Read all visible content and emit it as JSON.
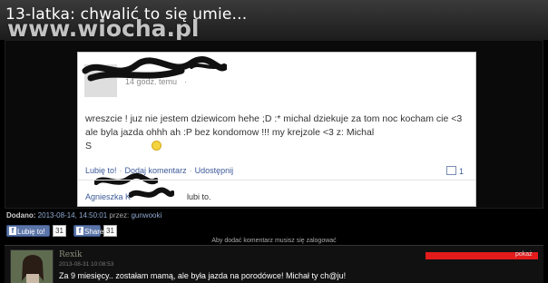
{
  "title": "13-latka: chwalić to się umie...",
  "logo": "www.wiocha.pl",
  "post": {
    "timestamp": "14 godz. temu",
    "text": "wreszcie ! juz nie jestem dziewicom hehe ;D :* michal dziekuje za tom noc kocham cie <3 ale byla jazda ohhh ah :P bez kondomow !!! my krejzole <3 z: Michal",
    "text_tail": "S",
    "actions": [
      "Lubię to!",
      "Dodaj komentarz",
      "Udostępnij"
    ],
    "comment_count": "1",
    "likes_prefix": "Agnieszka K",
    "likes_suffix": "lubi to."
  },
  "meta": {
    "added_label": "Dodano:",
    "added_value": "2013-08-14, 14:50:01",
    "by_label": "przez:",
    "by_value": "gunwooki"
  },
  "share": {
    "like_label": "Lubię to!",
    "like_count": "31",
    "fb_share_label": "Share",
    "fb_share_count": "31"
  },
  "notice": "Aby dodać komentarz musisz się zalogować",
  "comment": {
    "author": "Rexik",
    "date": "2013-08-31 10:08:53",
    "text": "Za 9 miesięcy.. zostałam mamą, ale była jazda na porodówce! Michał ty ch@ju!",
    "report_label": "pokaż"
  },
  "colors": {
    "facebook_blue": "#3b5998",
    "report_red": "#e31b1b"
  }
}
